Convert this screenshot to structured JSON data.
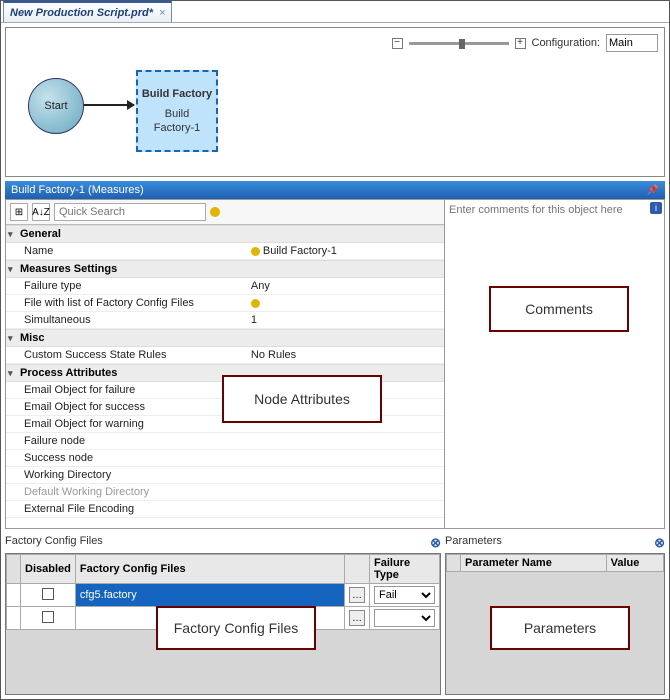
{
  "tab": {
    "title": "New Production Script.prd*",
    "close": "×"
  },
  "zoom": {
    "minus": "−",
    "plus": "+",
    "label": "Configuration:",
    "value": "Main"
  },
  "canvas": {
    "start_label": "Start",
    "build_title": "Build Factory",
    "build_sub": "Build\nFactory-1"
  },
  "section_header": {
    "title": "Build Factory-1 (Measures)",
    "pin": "📌"
  },
  "propgrid": {
    "search_placeholder": "Quick Search",
    "sort_icon": "A↓Z",
    "cat_icon": "⊞",
    "cats": {
      "general": {
        "label": "General",
        "rows": [
          {
            "k": "Name",
            "v": "Build Factory-1",
            "dot": true
          }
        ]
      },
      "measures": {
        "label": "Measures Settings",
        "rows": [
          {
            "k": "Failure type",
            "v": "Any"
          },
          {
            "k": "File with list of Factory Config Files",
            "v": "",
            "dot": true
          },
          {
            "k": "Simultaneous",
            "v": "1"
          }
        ]
      },
      "misc": {
        "label": "Misc",
        "rows": [
          {
            "k": "Custom Success State Rules",
            "v": "No Rules"
          }
        ]
      },
      "process": {
        "label": "Process Attributes",
        "rows": [
          {
            "k": "Email Object for failure",
            "v": ""
          },
          {
            "k": "Email Object for success",
            "v": ""
          },
          {
            "k": "Email Object for warning",
            "v": ""
          },
          {
            "k": "Failure node",
            "v": ""
          },
          {
            "k": "Success node",
            "v": ""
          },
          {
            "k": "Working Directory",
            "v": ""
          },
          {
            "k": "Default Working Directory",
            "v": "",
            "muted": true
          },
          {
            "k": "External File Encoding",
            "v": ""
          }
        ]
      }
    }
  },
  "comments": {
    "placeholder": "Enter comments for this object here"
  },
  "callouts": {
    "node_attributes": "Node Attributes",
    "comments": "Comments",
    "factory": "Factory Config Files",
    "parameters": "Parameters"
  },
  "bottom": {
    "factory": {
      "title": "Factory Config Files",
      "close": "⊗",
      "cols": {
        "disabled": "Disabled",
        "files": "Factory Config Files",
        "ftype": "Failure Type"
      },
      "rows": [
        {
          "file": "cfg5.factory",
          "ftype": "Fail"
        },
        {
          "file": "",
          "ftype": ""
        }
      ]
    },
    "params": {
      "title": "Parameters",
      "close": "⊗",
      "cols": {
        "name": "Parameter Name",
        "value": "Value"
      }
    }
  }
}
